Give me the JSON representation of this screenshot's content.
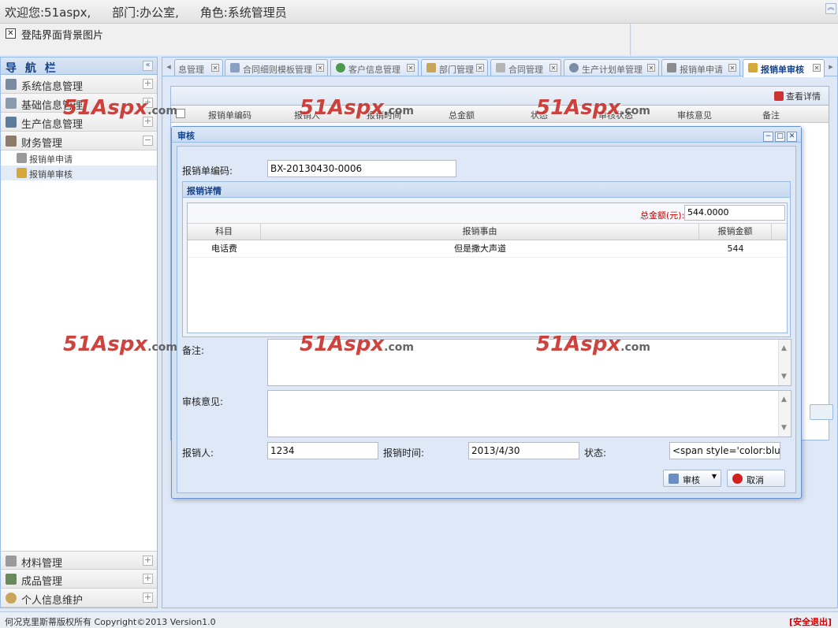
{
  "header": {
    "welcome": "欢迎您:51aspx,",
    "department": "部门:办公室,",
    "role": "角色:系统管理员",
    "collapse_icon": "double-chevron-up-icon"
  },
  "bg_toggle": {
    "label": "登陆界面背景图片",
    "checkbox_glyph": "✕"
  },
  "sidebar": {
    "title": "导 航 栏",
    "collapse_glyph": "«",
    "groups": [
      {
        "label": "系统信息管理",
        "toggle": "+",
        "icon_color": "#7a8aa0"
      },
      {
        "label": "基础信息管理",
        "toggle": "+",
        "icon_color": "#8a9bb0"
      },
      {
        "label": "生产信息管理",
        "toggle": "+",
        "icon_color": "#5c7c9c"
      },
      {
        "label": "财务管理",
        "toggle": "−",
        "icon_color": "#8c7b6a"
      }
    ],
    "sub_items": [
      {
        "label": "报销单申请"
      },
      {
        "label": "报销单审核"
      }
    ],
    "bottom_groups": [
      {
        "label": "材料管理",
        "toggle": "+"
      },
      {
        "label": "成品管理",
        "toggle": "+"
      },
      {
        "label": "个人信息维护",
        "toggle": "+"
      }
    ]
  },
  "tabs": [
    {
      "label": "息管理",
      "icon_color": "#9aa5b5"
    },
    {
      "label": "合同细则模板管理",
      "icon_color": "#8aa0c0"
    },
    {
      "label": "客户信息管理",
      "icon_color": "#4c9b4c"
    },
    {
      "label": "部门管理",
      "icon_color": "#c9a55a"
    },
    {
      "label": "合同管理",
      "icon_color": "#b5b5b5"
    },
    {
      "label": "生产计划单管理",
      "icon_color": "#7b8ea8"
    },
    {
      "label": "报销单申请",
      "icon_color": "#8c8c8c"
    },
    {
      "label": "报销单审核",
      "icon_color": "#d6a83a"
    }
  ],
  "grid": {
    "toolbar_detail": "查看详情",
    "columns": [
      "报销单编码",
      "报销人",
      "报销时间",
      "总金额",
      "状态",
      "审核状态",
      "审核意见",
      "备注"
    ]
  },
  "dialog": {
    "title": "审核",
    "window_buttons": [
      "−",
      "□",
      "✕"
    ],
    "code_label": "报销单编码:",
    "code_value": "BX-20130430-0006",
    "detail_title": "报销详情",
    "total_label": "总金额(元):",
    "total_value": "544.0000",
    "detail_columns": [
      "科目",
      "报销事由",
      "报销金额"
    ],
    "detail_rows": [
      {
        "subject": "电话费",
        "reason": "但是撒大声道",
        "amount": "544"
      }
    ],
    "remark_label": "备注:",
    "opinion_label": "审核意见:",
    "person_label": "报销人:",
    "person_value": "1234",
    "time_label": "报销时间:",
    "time_value": "2013/4/30",
    "status_label": "状态:",
    "status_value": "<span style='color:blue'>",
    "audit_button": "审核",
    "cancel_button": "取消"
  },
  "watermark": {
    "big": "51Aspx",
    "small": ".com"
  },
  "footer": {
    "copyright": "何况克里斯蒂版权所有  Copyright©2013 Version1.0",
    "logout": "[安全退出]"
  }
}
